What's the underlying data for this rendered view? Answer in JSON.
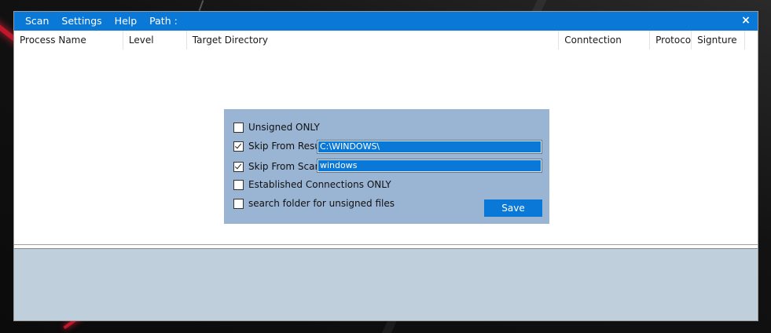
{
  "menubar": {
    "items": [
      "Scan",
      "Settings",
      "Help",
      "Path :"
    ],
    "close_glyph": "×"
  },
  "table": {
    "columns": [
      "Process Name",
      "Level",
      "Target Directory",
      "Conntection",
      "Protocol",
      "Signture"
    ],
    "rows": []
  },
  "options_dialog": {
    "unsigned_only": {
      "label": "Unsigned ONLY",
      "checked": false
    },
    "skip_from_result": {
      "label": "Skip From Result :",
      "checked": true,
      "value": "C:\\WINDOWS\\"
    },
    "skip_from_scan": {
      "label": "Skip From Scan :",
      "checked": true,
      "value": "windows"
    },
    "established_only": {
      "label": "Established Connections ONLY",
      "checked": false
    },
    "search_unsigned": {
      "label": "search folder for unsigned files",
      "checked": false
    },
    "save_label": "Save"
  },
  "colors": {
    "accent": "#0a78d7",
    "dialog_bg": "#9ab4d3",
    "lower_panel_bg": "#bfcfdc"
  }
}
